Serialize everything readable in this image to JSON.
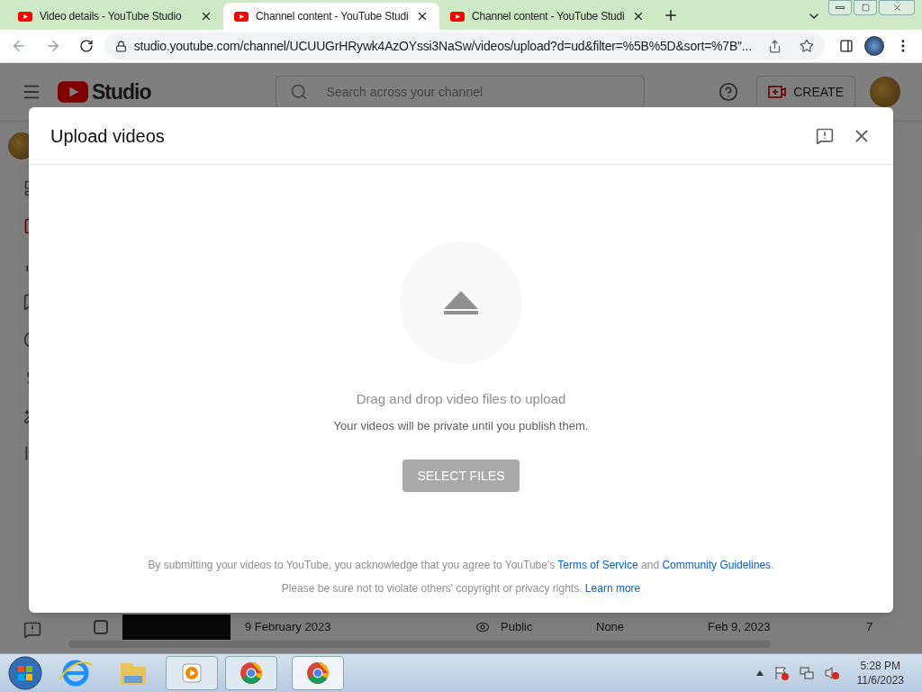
{
  "browser": {
    "tabs": [
      {
        "title": "Video details - YouTube Studio",
        "selected": false
      },
      {
        "title": "Channel content - YouTube Studi",
        "selected": true
      },
      {
        "title": "Channel content - YouTube Studi",
        "selected": false
      }
    ],
    "url": "studio.youtube.com/channel/UCUUGrHRywk4AzOYssi3NaSw/videos/upload?d=ud&filter=%5B%5D&sort=%7B\"..."
  },
  "header": {
    "logo": "Studio",
    "search": {
      "placeholder": "Search across your channel"
    },
    "create_button": "CREATE"
  },
  "video_row": {
    "checked": false,
    "title": "9 February 2023",
    "visibility": "Public",
    "restrictions": "None",
    "date": "Feb 9, 2023",
    "column_5": "7"
  },
  "dialog": {
    "title": "Upload videos",
    "drop_title": "Drag and drop video files to upload",
    "drop_subtitle": "Your videos will be private until you publish them.",
    "select_button": {
      "label": "SELECT FILES",
      "disabled": true
    },
    "legal": [
      [
        {
          "kind": "text",
          "text": "By submitting your videos to YouTube, you acknowledge that you agree to YouTube's "
        },
        {
          "kind": "link",
          "text": "Terms of Service"
        },
        {
          "kind": "text",
          "text": " and "
        },
        {
          "kind": "link",
          "text": "Community Guidelines"
        },
        {
          "kind": "text",
          "text": "."
        }
      ],
      [
        {
          "kind": "text",
          "text": "Please be sure not to violate others' copyright or privacy rights. "
        },
        {
          "kind": "link",
          "text": "Learn more"
        }
      ]
    ]
  },
  "taskbar": {
    "time": "5:28 PM",
    "date": "11/6/2023"
  }
}
